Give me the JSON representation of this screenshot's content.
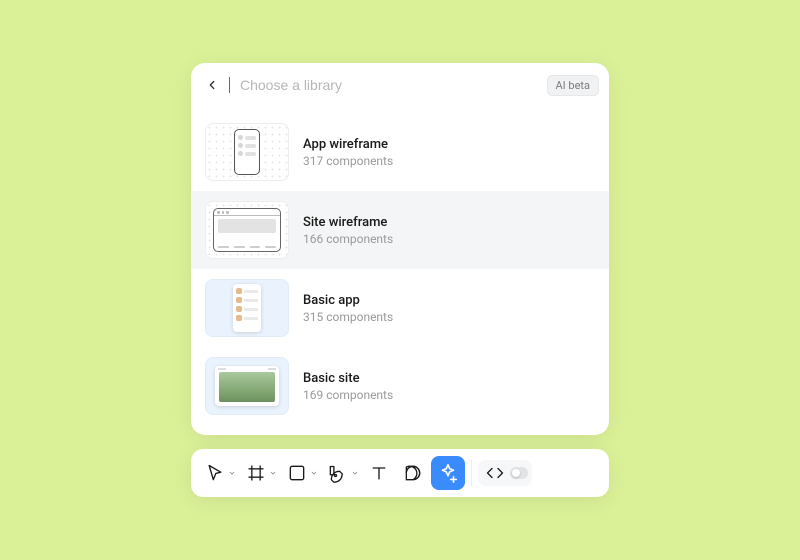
{
  "header": {
    "placeholder": "Choose a library",
    "badge": "AI beta"
  },
  "libraries": [
    {
      "title": "App wireframe",
      "subtitle": "317 components"
    },
    {
      "title": "Site wireframe",
      "subtitle": "166 components"
    },
    {
      "title": "Basic app",
      "subtitle": "315 components"
    },
    {
      "title": "Basic site",
      "subtitle": "169 components"
    }
  ],
  "toolbar": {
    "tools": [
      "move",
      "frame",
      "shape",
      "pen",
      "text",
      "comment",
      "ai",
      "code"
    ]
  }
}
